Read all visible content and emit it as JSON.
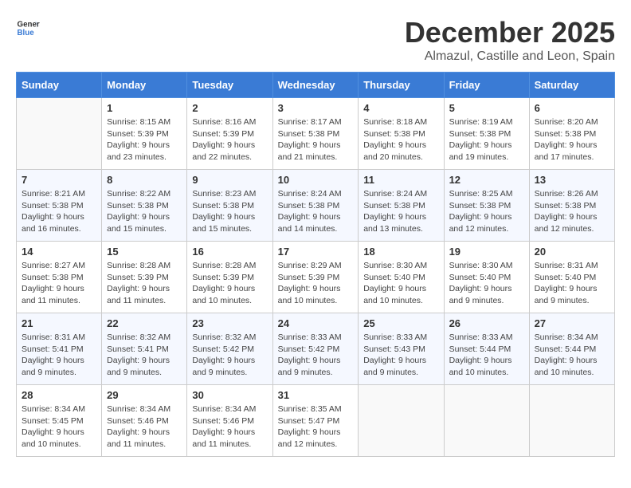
{
  "header": {
    "logo_general": "General",
    "logo_blue": "Blue",
    "month_title": "December 2025",
    "location": "Almazul, Castille and Leon, Spain"
  },
  "weekdays": [
    "Sunday",
    "Monday",
    "Tuesday",
    "Wednesday",
    "Thursday",
    "Friday",
    "Saturday"
  ],
  "weeks": [
    [
      {
        "day": "",
        "info": ""
      },
      {
        "day": "1",
        "info": "Sunrise: 8:15 AM\nSunset: 5:39 PM\nDaylight: 9 hours\nand 23 minutes."
      },
      {
        "day": "2",
        "info": "Sunrise: 8:16 AM\nSunset: 5:39 PM\nDaylight: 9 hours\nand 22 minutes."
      },
      {
        "day": "3",
        "info": "Sunrise: 8:17 AM\nSunset: 5:38 PM\nDaylight: 9 hours\nand 21 minutes."
      },
      {
        "day": "4",
        "info": "Sunrise: 8:18 AM\nSunset: 5:38 PM\nDaylight: 9 hours\nand 20 minutes."
      },
      {
        "day": "5",
        "info": "Sunrise: 8:19 AM\nSunset: 5:38 PM\nDaylight: 9 hours\nand 19 minutes."
      },
      {
        "day": "6",
        "info": "Sunrise: 8:20 AM\nSunset: 5:38 PM\nDaylight: 9 hours\nand 17 minutes."
      }
    ],
    [
      {
        "day": "7",
        "info": "Sunrise: 8:21 AM\nSunset: 5:38 PM\nDaylight: 9 hours\nand 16 minutes."
      },
      {
        "day": "8",
        "info": "Sunrise: 8:22 AM\nSunset: 5:38 PM\nDaylight: 9 hours\nand 15 minutes."
      },
      {
        "day": "9",
        "info": "Sunrise: 8:23 AM\nSunset: 5:38 PM\nDaylight: 9 hours\nand 15 minutes."
      },
      {
        "day": "10",
        "info": "Sunrise: 8:24 AM\nSunset: 5:38 PM\nDaylight: 9 hours\nand 14 minutes."
      },
      {
        "day": "11",
        "info": "Sunrise: 8:24 AM\nSunset: 5:38 PM\nDaylight: 9 hours\nand 13 minutes."
      },
      {
        "day": "12",
        "info": "Sunrise: 8:25 AM\nSunset: 5:38 PM\nDaylight: 9 hours\nand 12 minutes."
      },
      {
        "day": "13",
        "info": "Sunrise: 8:26 AM\nSunset: 5:38 PM\nDaylight: 9 hours\nand 12 minutes."
      }
    ],
    [
      {
        "day": "14",
        "info": "Sunrise: 8:27 AM\nSunset: 5:38 PM\nDaylight: 9 hours\nand 11 minutes."
      },
      {
        "day": "15",
        "info": "Sunrise: 8:28 AM\nSunset: 5:39 PM\nDaylight: 9 hours\nand 11 minutes."
      },
      {
        "day": "16",
        "info": "Sunrise: 8:28 AM\nSunset: 5:39 PM\nDaylight: 9 hours\nand 10 minutes."
      },
      {
        "day": "17",
        "info": "Sunrise: 8:29 AM\nSunset: 5:39 PM\nDaylight: 9 hours\nand 10 minutes."
      },
      {
        "day": "18",
        "info": "Sunrise: 8:30 AM\nSunset: 5:40 PM\nDaylight: 9 hours\nand 10 minutes."
      },
      {
        "day": "19",
        "info": "Sunrise: 8:30 AM\nSunset: 5:40 PM\nDaylight: 9 hours\nand 9 minutes."
      },
      {
        "day": "20",
        "info": "Sunrise: 8:31 AM\nSunset: 5:40 PM\nDaylight: 9 hours\nand 9 minutes."
      }
    ],
    [
      {
        "day": "21",
        "info": "Sunrise: 8:31 AM\nSunset: 5:41 PM\nDaylight: 9 hours\nand 9 minutes."
      },
      {
        "day": "22",
        "info": "Sunrise: 8:32 AM\nSunset: 5:41 PM\nDaylight: 9 hours\nand 9 minutes."
      },
      {
        "day": "23",
        "info": "Sunrise: 8:32 AM\nSunset: 5:42 PM\nDaylight: 9 hours\nand 9 minutes."
      },
      {
        "day": "24",
        "info": "Sunrise: 8:33 AM\nSunset: 5:42 PM\nDaylight: 9 hours\nand 9 minutes."
      },
      {
        "day": "25",
        "info": "Sunrise: 8:33 AM\nSunset: 5:43 PM\nDaylight: 9 hours\nand 9 minutes."
      },
      {
        "day": "26",
        "info": "Sunrise: 8:33 AM\nSunset: 5:44 PM\nDaylight: 9 hours\nand 10 minutes."
      },
      {
        "day": "27",
        "info": "Sunrise: 8:34 AM\nSunset: 5:44 PM\nDaylight: 9 hours\nand 10 minutes."
      }
    ],
    [
      {
        "day": "28",
        "info": "Sunrise: 8:34 AM\nSunset: 5:45 PM\nDaylight: 9 hours\nand 10 minutes."
      },
      {
        "day": "29",
        "info": "Sunrise: 8:34 AM\nSunset: 5:46 PM\nDaylight: 9 hours\nand 11 minutes."
      },
      {
        "day": "30",
        "info": "Sunrise: 8:34 AM\nSunset: 5:46 PM\nDaylight: 9 hours\nand 11 minutes."
      },
      {
        "day": "31",
        "info": "Sunrise: 8:35 AM\nSunset: 5:47 PM\nDaylight: 9 hours\nand 12 minutes."
      },
      {
        "day": "",
        "info": ""
      },
      {
        "day": "",
        "info": ""
      },
      {
        "day": "",
        "info": ""
      }
    ]
  ]
}
